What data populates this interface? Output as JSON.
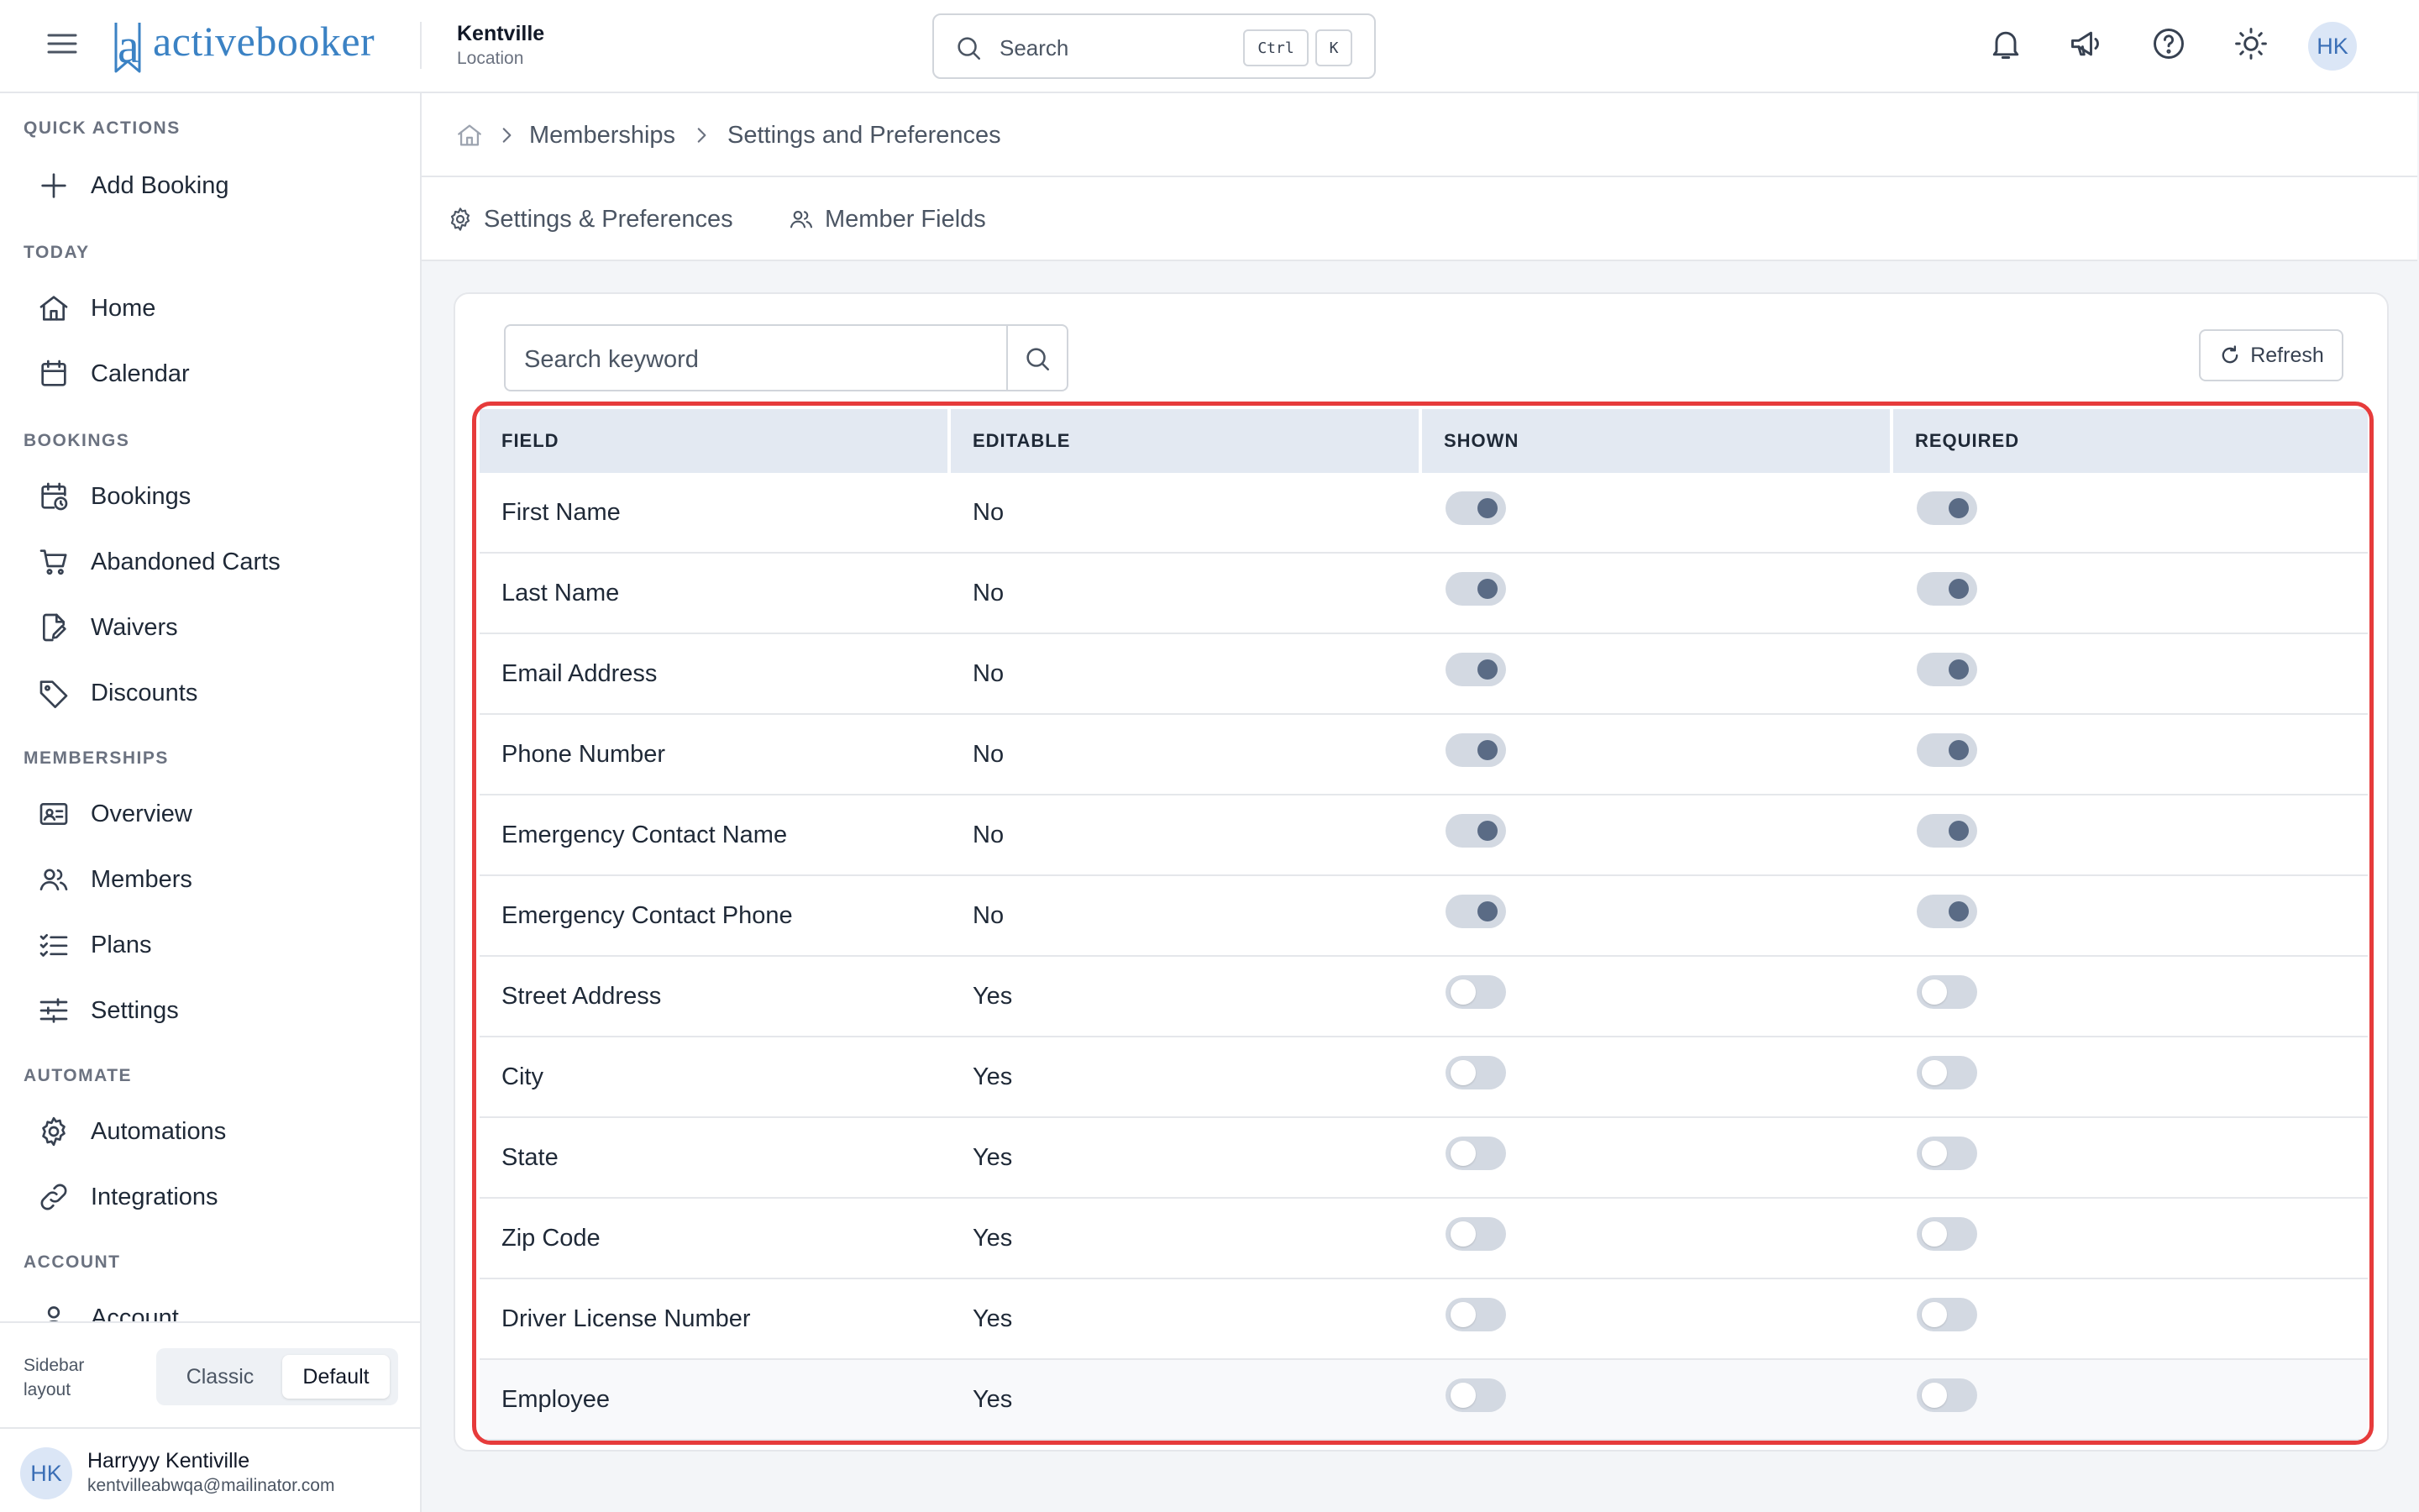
{
  "header": {
    "logo_text": "activebooker",
    "location_name": "Kentville",
    "location_sub": "Location",
    "search_label": "Search",
    "kbd_ctrl": "Ctrl",
    "kbd_k": "K",
    "avatar_initials": "HK"
  },
  "sidebar": {
    "sections": [
      {
        "title": "QUICK ACTIONS",
        "items": [
          {
            "label": "Add Booking",
            "icon": "plus-icon"
          }
        ]
      },
      {
        "title": "TODAY",
        "items": [
          {
            "label": "Home",
            "icon": "home-icon"
          },
          {
            "label": "Calendar",
            "icon": "calendar-icon"
          }
        ]
      },
      {
        "title": "BOOKINGS",
        "items": [
          {
            "label": "Bookings",
            "icon": "calendar-clock-icon"
          },
          {
            "label": "Abandoned Carts",
            "icon": "cart-icon"
          },
          {
            "label": "Waivers",
            "icon": "file-signature-icon"
          },
          {
            "label": "Discounts",
            "icon": "tag-icon"
          }
        ]
      },
      {
        "title": "MEMBERSHIPS",
        "items": [
          {
            "label": "Overview",
            "icon": "id-card-icon"
          },
          {
            "label": "Members",
            "icon": "users-icon"
          },
          {
            "label": "Plans",
            "icon": "list-check-icon"
          },
          {
            "label": "Settings",
            "icon": "sliders-icon"
          }
        ]
      },
      {
        "title": "AUTOMATE",
        "items": [
          {
            "label": "Automations",
            "icon": "gear-icon"
          },
          {
            "label": "Integrations",
            "icon": "link-icon"
          }
        ]
      },
      {
        "title": "ACCOUNT",
        "items": [
          {
            "label": "Account",
            "icon": "user-icon"
          }
        ]
      }
    ],
    "layout_label": "Sidebar layout",
    "layout_options": [
      "Classic",
      "Default"
    ],
    "layout_selected": "Default",
    "user": {
      "initials": "HK",
      "name": "Harryyy Kentiville",
      "email": "kentvilleabwqa@mailinator.com"
    }
  },
  "breadcrumb": [
    "Memberships",
    "Settings and Preferences"
  ],
  "tabs": [
    {
      "label": "Settings & Preferences",
      "icon": "gear-icon"
    },
    {
      "label": "Member Fields",
      "icon": "users-icon"
    }
  ],
  "toolbar": {
    "search_placeholder": "Search keyword",
    "refresh_label": "Refresh"
  },
  "table": {
    "columns": [
      "FIELD",
      "EDITABLE",
      "SHOWN",
      "REQUIRED"
    ],
    "rows": [
      {
        "field": "First Name",
        "editable": "No",
        "shown": true,
        "required": true
      },
      {
        "field": "Last Name",
        "editable": "No",
        "shown": true,
        "required": true
      },
      {
        "field": "Email Address",
        "editable": "No",
        "shown": true,
        "required": true
      },
      {
        "field": "Phone Number",
        "editable": "No",
        "shown": true,
        "required": true
      },
      {
        "field": "Emergency Contact Name",
        "editable": "No",
        "shown": true,
        "required": true
      },
      {
        "field": "Emergency Contact Phone",
        "editable": "No",
        "shown": true,
        "required": true
      },
      {
        "field": "Street Address",
        "editable": "Yes",
        "shown": false,
        "required": false
      },
      {
        "field": "City",
        "editable": "Yes",
        "shown": false,
        "required": false
      },
      {
        "field": "State",
        "editable": "Yes",
        "shown": false,
        "required": false
      },
      {
        "field": "Zip Code",
        "editable": "Yes",
        "shown": false,
        "required": false
      },
      {
        "field": "Driver License Number",
        "editable": "Yes",
        "shown": false,
        "required": false
      },
      {
        "field": "Employee",
        "editable": "Yes",
        "shown": false,
        "required": false
      }
    ]
  },
  "colors": {
    "brand": "#3b82c4",
    "highlight_border": "#e63b3b",
    "toggle_on_knob": "#5a6b85",
    "table_header_bg": "#e3e9f2"
  }
}
